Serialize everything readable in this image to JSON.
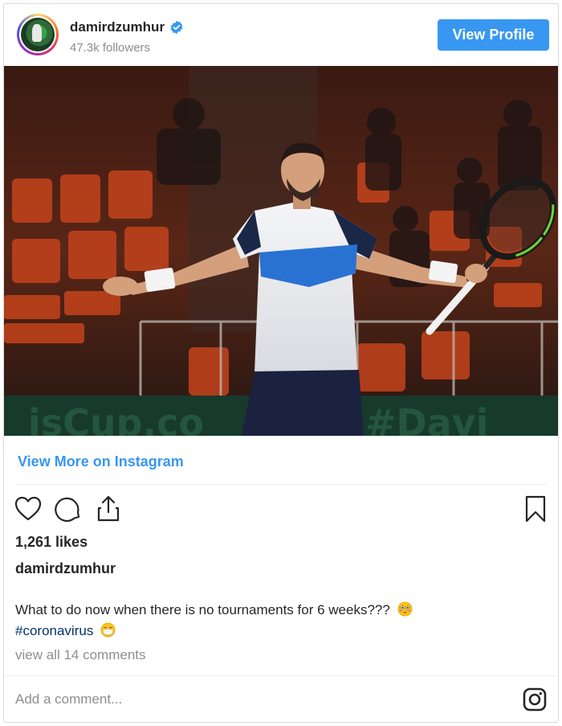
{
  "header": {
    "username": "damirdzumhur",
    "followers": "47.3k followers",
    "view_profile_label": "View Profile"
  },
  "photo": {
    "alt": "Tennis player in white and blue shirt holding racket with arms spread in an arena"
  },
  "links": {
    "view_more": "View More on Instagram"
  },
  "post": {
    "likes": "1,261 likes",
    "caption_username": "damirdzumhur",
    "caption_text": "What to do now when there is no tournaments for 6 weeks???",
    "hashtag": "#coronavirus",
    "view_comments": "view all 14 comments"
  },
  "comment": {
    "placeholder": "Add a comment..."
  },
  "colors": {
    "accent": "#3897f0",
    "hashtag": "#003569",
    "muted": "#8e8e8e"
  },
  "icons": [
    "verified-badge-icon",
    "heart-icon",
    "comment-icon",
    "share-icon",
    "bookmark-icon",
    "instagram-logo-icon",
    "flushed-face-emoji",
    "mask-face-emoji"
  ]
}
